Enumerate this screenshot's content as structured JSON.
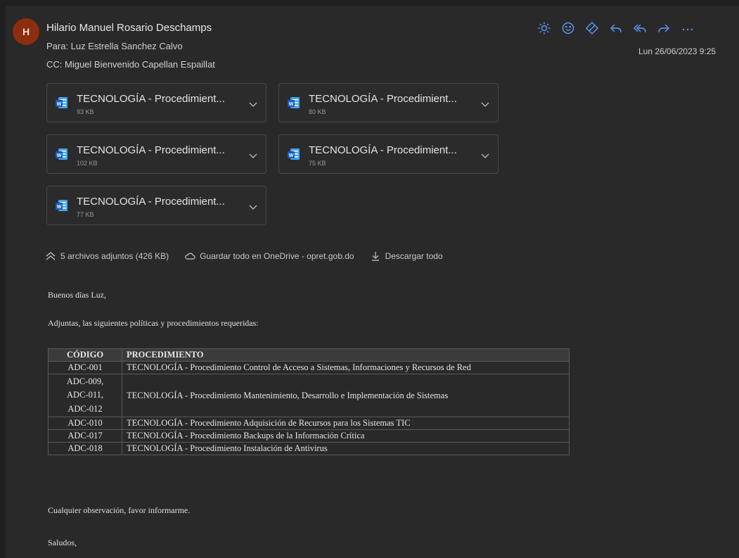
{
  "header": {
    "avatar_initial": "H",
    "sender": "Hilario Manuel Rosario Deschamps",
    "to": "Para: Luz Estrella Sanchez Calvo",
    "cc": "CC: Miguel Bienvenido Capellan Espaillat",
    "date": "Lun 26/06/2023 9:25"
  },
  "toolbar": {
    "icons": [
      "sun-icon",
      "emoji-icon",
      "tag-icon",
      "reply-icon",
      "reply-all-icon",
      "forward-icon",
      "more-icon"
    ]
  },
  "attachments": [
    {
      "name": "TECNOLOGÍA - Procedimient...",
      "size": "93 KB"
    },
    {
      "name": "TECNOLOGÍA - Procedimient...",
      "size": "80 KB"
    },
    {
      "name": "TECNOLOGÍA - Procedimient...",
      "size": "102 KB"
    },
    {
      "name": "TECNOLOGÍA - Procedimient...",
      "size": "75 KB"
    },
    {
      "name": "TECNOLOGÍA - Procedimient...",
      "size": "77 KB"
    }
  ],
  "attachment_bar": {
    "summary": "5 archivos adjuntos (426 KB)",
    "save_onedrive": "Guardar todo en OneDrive - opret.gob.do",
    "download_all": "Descargar todo"
  },
  "message": {
    "greeting": "Buenos días Luz,",
    "intro": "Adjuntas, las siguientes políticas y procedimientos requeridas:",
    "table": {
      "headers": [
        "CÓDIGO",
        "PROCEDIMIENTO"
      ],
      "rows": [
        {
          "code": "ADC-001",
          "proc": "TECNOLOGÍA - Procedimiento Control de Acceso a Sistemas, Informaciones y Recursos de Red"
        },
        {
          "code": "ADC-009,\nADC-011,\nADC-012",
          "proc": "TECNOLOGÍA - Procedimiento Mantenimiento, Desarrollo e Implementación de Sistemas"
        },
        {
          "code": "ADC-010",
          "proc": "TECNOLOGÍA - Procedimiento Adquisición de Recursos para los Sistemas TIC"
        },
        {
          "code": "ADC-017",
          "proc": "TECNOLOGÍA - Procedimiento Backups de la Información Crítica"
        },
        {
          "code": "ADC-018",
          "proc": "TECNOLOGÍA - Procedimiento Instalación de Antivirus"
        }
      ]
    },
    "closing": "Cualquier observación, favor informarme.",
    "signoff": "Saludos,"
  },
  "colors": {
    "background": "#292929",
    "avatar": "#8b2d0e",
    "accent_blue": "#5b9bff"
  }
}
